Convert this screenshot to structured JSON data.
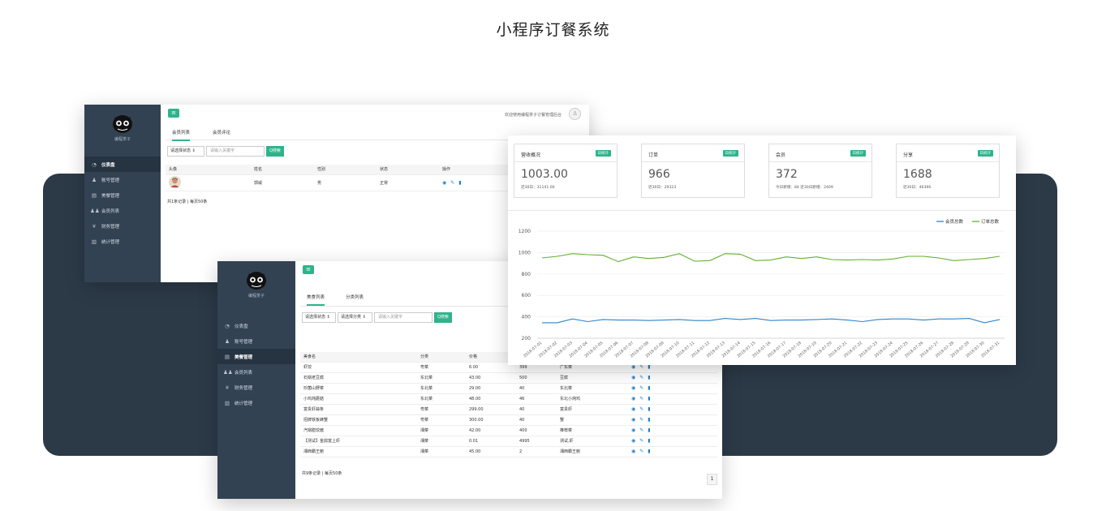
{
  "page": {
    "title": "小程序订餐系统"
  },
  "brand": {
    "name": "编程茶子",
    "accent": "#2fb38b",
    "sidebar_bg": "#324253",
    "band_bg": "#2c3a48"
  },
  "win1": {
    "welcome": "欢迎使用编程茶子订餐管理后台",
    "menu_icon": "menu-icon",
    "nav": [
      {
        "icon": "dashboard-icon",
        "glyph": "◔",
        "label": "仪表盘"
      },
      {
        "icon": "user-icon",
        "glyph": "♟",
        "label": "账号管理"
      },
      {
        "icon": "book-icon",
        "glyph": "▤",
        "label": "美餐管理"
      },
      {
        "icon": "users-icon",
        "glyph": "♟♟",
        "label": "会员列表"
      },
      {
        "icon": "yen-icon",
        "glyph": "¥",
        "label": "财务管理"
      },
      {
        "icon": "bar-chart-icon",
        "glyph": "▥",
        "label": "统计管理"
      }
    ],
    "tabs": [
      "会员列表",
      "会员评论"
    ],
    "status_select": "请选择状态 ⇕",
    "search_placeholder": "请输入关键字",
    "search_btn": "Q搜索",
    "columns": [
      "头像",
      "姓名",
      "性别",
      "状态",
      "操作"
    ],
    "rows": [
      {
        "name": "郭威",
        "gender": "男",
        "status": "正常"
      }
    ],
    "footer": "共1条记录 | 每页50条"
  },
  "win2": {
    "tabs": [
      "美食列表",
      "分类列表"
    ],
    "status_select": "请选择状态 ⇕",
    "category_select": "请选择分类 ⇕",
    "search_placeholder": "请输入关键字",
    "search_btn": "Q搜索",
    "columns": [
      "美食名",
      "分类",
      "价格",
      "",
      "",
      ""
    ],
    "rows": [
      [
        "虾饺",
        "粤菜",
        "6.00",
        "399",
        "广东菜"
      ],
      [
        "石锅老豆腐",
        "东北菜",
        "43.00",
        "500",
        "豆腐"
      ],
      [
        "珍菌山野菜",
        "东北菜",
        "29.00",
        "40",
        "东北菜"
      ],
      [
        "小鸡炖蘑菇",
        "东北菜",
        "48.00",
        "46",
        "东北小炖鸡"
      ],
      [
        "富贵虾蒜条",
        "粤菜",
        "299.00",
        "40",
        "富贵虾"
      ],
      [
        "招牌铁板蜂蟹",
        "粤菜",
        "300.00",
        "40",
        "蟹"
      ],
      [
        "汽锅腊饺酱",
        "湘菜",
        "42.00",
        "400",
        "推荐菜"
      ],
      [
        "【测试】金鼎富上虾",
        "湘菜",
        "0.01",
        "4995",
        "测试,虾"
      ],
      [
        "湘西霸王鲍",
        "湘菜",
        "45.00",
        "2",
        "湘西霸王鲍"
      ]
    ],
    "footer": "共9条记录 | 每页50条",
    "page": "1"
  },
  "dashboard": {
    "badge": "日统计",
    "cards": [
      {
        "title": "营收概况",
        "value": "1003.00",
        "sub": "近30日：31141.00"
      },
      {
        "title": "订单",
        "value": "966",
        "sub": "近30日：29323"
      },
      {
        "title": "会员",
        "value": "372",
        "sub": "今日新增：84  近30日新增：2409"
      },
      {
        "title": "分享",
        "value": "1688",
        "sub": "近30日：46396"
      }
    ]
  },
  "chart_data": {
    "type": "line",
    "x": [
      "2018-07-01",
      "2018-07-02",
      "2018-07-03",
      "2018-07-04",
      "2018-07-05",
      "2018-07-06",
      "2018-07-07",
      "2018-07-08",
      "2018-07-09",
      "2018-07-10",
      "2018-07-11",
      "2018-07-12",
      "2018-07-13",
      "2018-07-14",
      "2018-07-15",
      "2018-07-16",
      "2018-07-17",
      "2018-07-18",
      "2018-07-19",
      "2018-07-20",
      "2018-07-21",
      "2018-07-22",
      "2018-07-23",
      "2018-07-24",
      "2018-07-25",
      "2018-07-26",
      "2018-07-27",
      "2018-07-28",
      "2018-07-29",
      "2018-07-30",
      "2018-07-31"
    ],
    "series": [
      {
        "name": "会员总数",
        "color": "#2f84c8",
        "values": [
          345,
          345,
          380,
          355,
          375,
          370,
          370,
          365,
          370,
          375,
          365,
          365,
          385,
          375,
          385,
          365,
          370,
          370,
          375,
          380,
          370,
          355,
          375,
          380,
          380,
          370,
          380,
          380,
          385,
          345,
          375
        ]
      },
      {
        "name": "订单总数",
        "color": "#62b030",
        "values": [
          950,
          965,
          990,
          980,
          975,
          915,
          960,
          945,
          955,
          990,
          920,
          925,
          990,
          985,
          925,
          930,
          960,
          945,
          960,
          935,
          930,
          935,
          930,
          940,
          965,
          965,
          950,
          925,
          935,
          945,
          965
        ]
      }
    ],
    "ylim": [
      200,
      1200
    ],
    "yticks": [
      200,
      400,
      600,
      800,
      1000,
      1200
    ],
    "legend": "top-right",
    "grid": true
  }
}
